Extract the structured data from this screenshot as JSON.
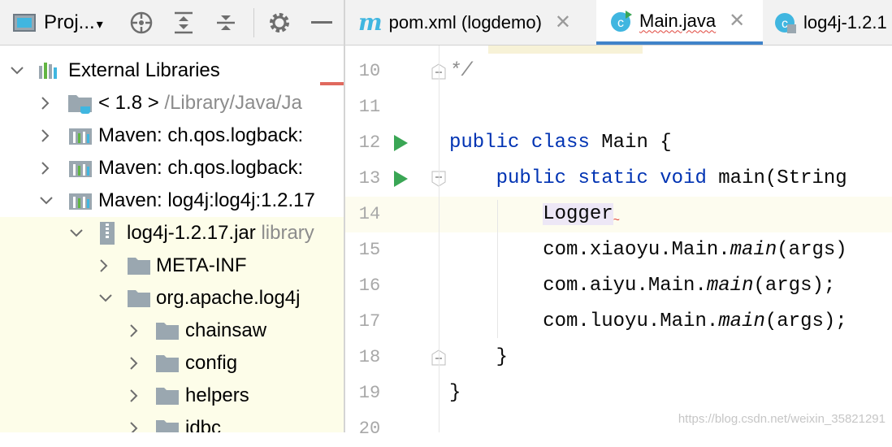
{
  "project_panel": {
    "title": "Proj...",
    "tree": [
      {
        "label": "External Libraries",
        "dim": "",
        "expanded": true
      },
      {
        "label": "< 1.8 >",
        "dim": "/Library/Java/Ja",
        "expanded": false
      },
      {
        "label": "Maven: ch.qos.logback:",
        "dim": "",
        "expanded": false
      },
      {
        "label": "Maven: ch.qos.logback:",
        "dim": "",
        "expanded": false
      },
      {
        "label": "Maven: log4j:log4j:1.2.17",
        "dim": "",
        "expanded": true
      },
      {
        "label": "log4j-1.2.17.jar",
        "dim": "library",
        "expanded": true
      },
      {
        "label": "META-INF",
        "dim": "",
        "expanded": false
      },
      {
        "label": "org.apache.log4j",
        "dim": "",
        "expanded": true
      },
      {
        "label": "chainsaw",
        "dim": "",
        "expanded": false
      },
      {
        "label": "config",
        "dim": "",
        "expanded": false
      },
      {
        "label": "helpers",
        "dim": "",
        "expanded": false
      },
      {
        "label": "jdbc",
        "dim": "",
        "expanded": false
      }
    ]
  },
  "tabs": [
    {
      "label": "pom.xml (logdemo)",
      "icon": "maven-m-icon"
    },
    {
      "label": "Main.java",
      "icon": "class-c-icon"
    },
    {
      "label": "log4j-1.2.1",
      "icon": "class-c-icon"
    }
  ],
  "editor": {
    "line_numbers": [
      "10",
      "11",
      "12",
      "13",
      "14",
      "15",
      "16",
      "17",
      "18",
      "19",
      "20"
    ],
    "code": {
      "l10": "*/",
      "l12_kw1": "public",
      "l12_kw2": "class",
      "l12_rest": " Main {",
      "l13_kw1": "public",
      "l13_kw2": "static",
      "l13_kw3": "void",
      "l13_rest": " main(String",
      "l14": "Logger",
      "l15_pre": "com.xiaoyu.Main.",
      "l15_it": "main",
      "l15_post": "(args)",
      "l16_pre": "com.aiyu.Main.",
      "l16_it": "main",
      "l16_post": "(args);",
      "l17_pre": "com.luoyu.Main.",
      "l17_it": "main",
      "l17_post": "(args);",
      "l18": "}",
      "l19": "}"
    }
  },
  "watermark": "https://blog.csdn.net/weixin_35821291",
  "colors": {
    "keyword": "#0033b3",
    "active_tab": "#4083c9",
    "current_line": "#fdfcef",
    "run_arrow": "#3aa655"
  }
}
